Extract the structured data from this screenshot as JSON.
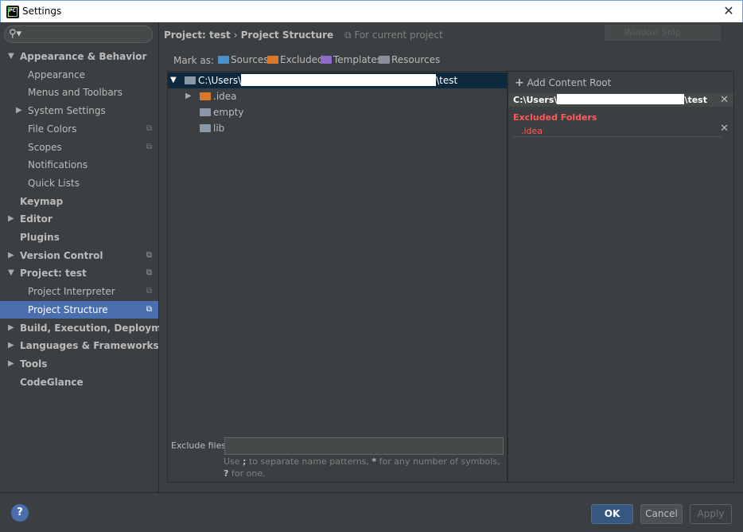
{
  "window": {
    "title": "Settings"
  },
  "sidebar": {
    "items": [
      {
        "label": "Appearance & Behavior"
      },
      {
        "label": "Appearance"
      },
      {
        "label": "Menus and Toolbars"
      },
      {
        "label": "System Settings"
      },
      {
        "label": "File Colors"
      },
      {
        "label": "Scopes"
      },
      {
        "label": "Notifications"
      },
      {
        "label": "Quick Lists"
      },
      {
        "label": "Keymap"
      },
      {
        "label": "Editor"
      },
      {
        "label": "Plugins"
      },
      {
        "label": "Version Control"
      },
      {
        "label": "Project: test"
      },
      {
        "label": "Project Interpreter"
      },
      {
        "label": "Project Structure"
      },
      {
        "label": "Build, Execution, Deployment"
      },
      {
        "label": "Languages & Frameworks"
      },
      {
        "label": "Tools"
      },
      {
        "label": "CodeGlance"
      }
    ],
    "selected": "Project Structure"
  },
  "breadcrumb": {
    "parent": "Project: test",
    "current": "Project Structure",
    "note": "For current project"
  },
  "overlay": {
    "window_snap": "Window Snip"
  },
  "mark_as": {
    "label": "Mark as:",
    "sources": "Sources",
    "excluded": "Excluded",
    "templates": "Templates",
    "resources": "Resources"
  },
  "tree": {
    "root_prefix": "C:\\Users\\",
    "root_suffix": "\\test",
    "children": [
      ".idea",
      "empty",
      "lib"
    ]
  },
  "content_root": {
    "add_label": "Add Content Root",
    "path_prefix": "C:\\Users\\",
    "path_suffix": "\\test",
    "excluded_header": "Excluded Folders",
    "excluded_items": [
      ".idea"
    ]
  },
  "exclude_files": {
    "label": "Exclude files:",
    "value": "",
    "hint_pre": "Use ",
    "hint_semicolon": ";",
    "hint_mid": " to separate name patterns, ",
    "hint_star": "*",
    "hint_mid2": " for any number of symbols, ",
    "hint_q": "?",
    "hint_post": " for one."
  },
  "buttons": {
    "help": "?",
    "ok": "OK",
    "cancel": "Cancel",
    "apply": "Apply"
  },
  "colors": {
    "selection": "#4b6eaf",
    "excluded": "#ff5a5a",
    "ok_button": "#365880"
  }
}
